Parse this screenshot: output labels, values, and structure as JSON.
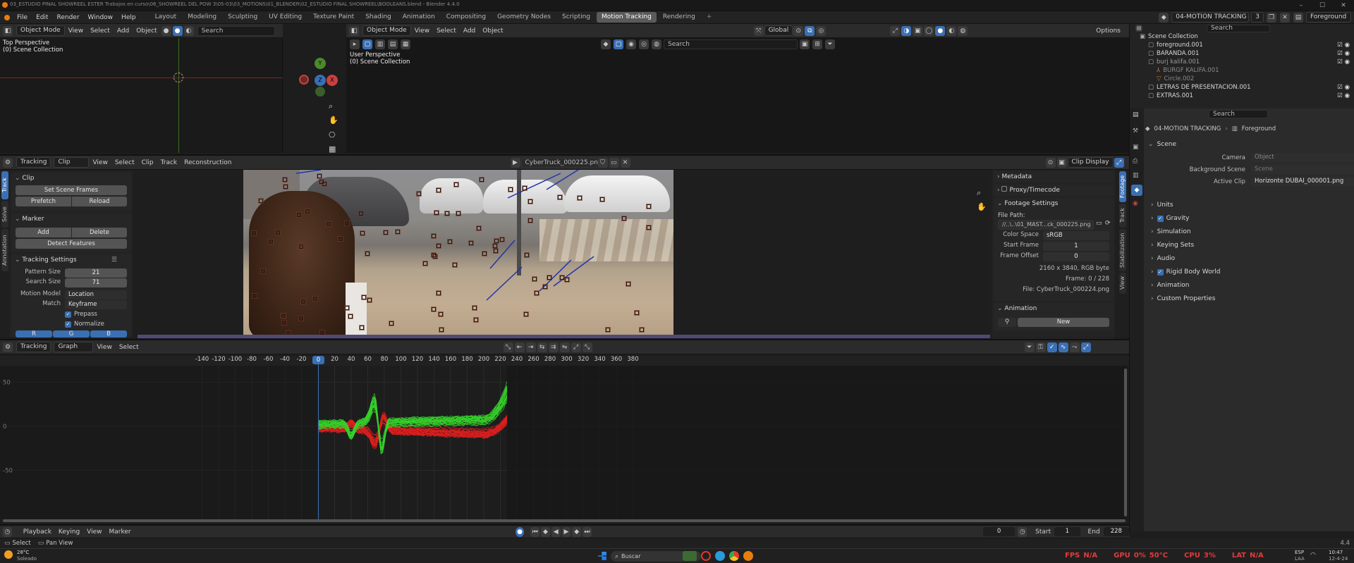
{
  "window": {
    "title": "03_ESTUDIO PINAL SHOWREEL ESTER Trabajos en curso\\06_SHOWREEL DEL POW 3\\05-03\\03_MOTIONS\\01_BLENDER\\02_ESTUDIO FINAL SHOWREEL\\BOOLEANS.blend - Blender 4.4.0"
  },
  "menus": [
    "File",
    "Edit",
    "Render",
    "Window",
    "Help"
  ],
  "workspaces": [
    "Layout",
    "Modeling",
    "Sculpting",
    "UV Editing",
    "Texture Paint",
    "Shading",
    "Animation",
    "Compositing",
    "Geometry Nodes",
    "Scripting",
    "Motion Tracking",
    "Rendering"
  ],
  "active_workspace": "Motion Tracking",
  "scene_selector": {
    "scene": "04-MOTION TRACKING",
    "users": "3",
    "view_layer": "Foreground"
  },
  "search_placeholder": "Search",
  "left_viewport": {
    "mode": "Object Mode",
    "menus": [
      "View",
      "Select",
      "Add",
      "Object"
    ],
    "label1": "Top Perspective",
    "label2": "(0) Scene Collection",
    "gizmo": {
      "x": "X",
      "y": "Y",
      "z": "Z"
    }
  },
  "center_viewport": {
    "mode": "Object Mode",
    "menus": [
      "View",
      "Select",
      "Add",
      "Object"
    ],
    "transform": "Global",
    "label1": "User Perspective",
    "label2": "(0) Scene Collection",
    "options": "Options"
  },
  "outliner": {
    "header": "Scene Collection",
    "items": [
      {
        "name": "foreground.001",
        "indent": 1
      },
      {
        "name": "BARANDA.001",
        "indent": 1
      },
      {
        "name": "burj kalifa.001",
        "indent": 1
      },
      {
        "name": "BURGF KALIFA.001",
        "indent": 2
      },
      {
        "name": "Circle.002",
        "indent": 2
      },
      {
        "name": "LETRAS DE PRESENTACION.001",
        "indent": 1
      },
      {
        "name": "EXTRAS.001",
        "indent": 1
      }
    ]
  },
  "properties": {
    "breadcrumb1": "04-MOTION TRACKING",
    "breadcrumb2": "Foreground",
    "section": "Scene",
    "camera_label": "Camera",
    "camera_value": "Object",
    "bg_label": "Background Scene",
    "bg_value": "Scene",
    "clip_label": "Active Clip",
    "clip_value": "Horizonte DUBAI_000001.png",
    "panels": [
      "Units",
      "Gravity",
      "Simulation",
      "Keying Sets",
      "Audio",
      "Rigid Body World",
      "Animation",
      "Custom Properties"
    ]
  },
  "clip_editor": {
    "mode": "Tracking",
    "view": "Clip",
    "menus": [
      "View",
      "Select",
      "Clip",
      "Track",
      "Reconstruction"
    ],
    "clip_name": "CyberTruck_000225.png",
    "display": "Clip Display"
  },
  "tool_panel": {
    "clip_title": "Clip",
    "set_scene_frames": "Set Scene Frames",
    "prefetch": "Prefetch",
    "reload": "Reload",
    "marker_title": "Marker",
    "add": "Add",
    "delete": "Delete",
    "detect": "Detect Features",
    "settings_title": "Tracking Settings",
    "pattern_size_label": "Pattern Size",
    "pattern_size": "21",
    "search_size_label": "Search Size",
    "search_size": "71",
    "motion_label": "Motion Model",
    "motion": "Location",
    "match_label": "Match",
    "match": "Keyframe",
    "prepass": "Prepass",
    "normalize": "Normalize",
    "r": "R",
    "g": "G",
    "b": "B"
  },
  "left_tabs": [
    "Track",
    "Solve",
    "Annotation"
  ],
  "right_tabs": [
    "Footage",
    "Track",
    "Stabilization",
    "View"
  ],
  "footage_panel": {
    "metadata": "Metadata",
    "proxy": "Proxy/Timecode",
    "settings": "Footage Settings",
    "file_path_label": "File Path:",
    "file_path": "//..\\..\\01_MAST...ck_000225.png",
    "color_space_label": "Color Space",
    "color_space": "sRGB",
    "start_frame_label": "Start Frame",
    "start_frame": "1",
    "frame_offset_label": "Frame Offset",
    "frame_offset": "0",
    "resolution": "2160 x 3840, RGB byte",
    "frame_info": "Frame: 0 / 228",
    "file_info": "File: CyberTruck_000224.png",
    "animation": "Animation",
    "new": "New"
  },
  "graph_editor": {
    "mode": "Tracking",
    "view": "Graph",
    "menus": [
      "View",
      "Select"
    ],
    "current_frame": "0",
    "ticks": [
      "-140",
      "-120",
      "-100",
      "-80",
      "-60",
      "-40",
      "-20",
      "0",
      "20",
      "40",
      "60",
      "80",
      "100",
      "120",
      "140",
      "160",
      "180",
      "200",
      "220",
      "240",
      "260",
      "280",
      "300",
      "320",
      "340",
      "360",
      "380"
    ],
    "yticks": [
      "50",
      "0",
      "-50"
    ]
  },
  "timeline": {
    "menus": [
      "Playback",
      "Keying",
      "View",
      "Marker"
    ],
    "frame": "0",
    "start_label": "Start",
    "start": "1",
    "end_label": "End",
    "end": "228"
  },
  "statusbar": {
    "select": "Select",
    "pan": "Pan View",
    "version": "4.4"
  },
  "taskbar": {
    "weather_temp": "28°C",
    "weather_desc": "Soleado",
    "search": "Buscar",
    "fps_label": "FPS",
    "fps": "N/A",
    "gpu_label": "GPU",
    "gpu": "0%",
    "gpu_temp": "50°C",
    "cpu_label": "CPU",
    "cpu": "3%",
    "lat_label": "LAT",
    "lat": "N/A",
    "lang": "ESP",
    "lang2": "LAA",
    "time": "10:47",
    "date": "12-4-24"
  },
  "colors": {
    "accent": "#3b6fb3",
    "curve_red": "#e01e1e",
    "curve_green": "#36d22a",
    "track_line": "#2233aa"
  }
}
